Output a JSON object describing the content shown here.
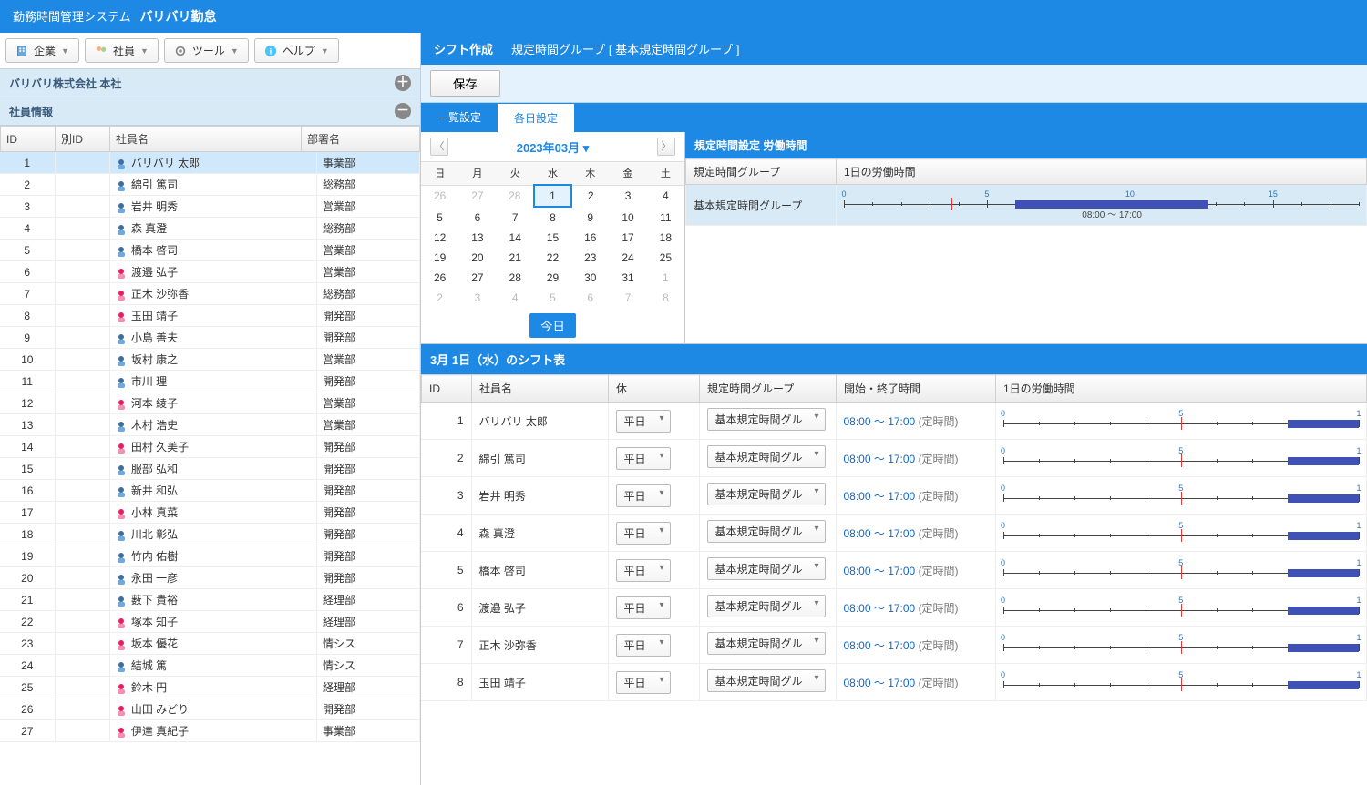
{
  "header": {
    "system_label": "勤務時間管理システム",
    "app_name": "バリバリ勤怠"
  },
  "toolbar": {
    "company": "企業",
    "employee": "社員",
    "tool": "ツール",
    "help": "ヘルプ"
  },
  "left": {
    "company_panel_title": "バリバリ株式会社 本社",
    "emp_panel_title": "社員情報",
    "columns": {
      "id": "ID",
      "alt_id": "別ID",
      "name": "社員名",
      "dept": "部署名"
    },
    "employees": [
      {
        "id": 1,
        "name": "バリバリ 太郎",
        "dept": "事業部",
        "g": "m"
      },
      {
        "id": 2,
        "name": "綿引 篤司",
        "dept": "総務部",
        "g": "m"
      },
      {
        "id": 3,
        "name": "岩井 明秀",
        "dept": "営業部",
        "g": "m"
      },
      {
        "id": 4,
        "name": "森 真澄",
        "dept": "総務部",
        "g": "m"
      },
      {
        "id": 5,
        "name": "橋本 啓司",
        "dept": "営業部",
        "g": "m"
      },
      {
        "id": 6,
        "name": "渡邉 弘子",
        "dept": "営業部",
        "g": "f"
      },
      {
        "id": 7,
        "name": "正木 沙弥香",
        "dept": "総務部",
        "g": "f"
      },
      {
        "id": 8,
        "name": "玉田 靖子",
        "dept": "開発部",
        "g": "f"
      },
      {
        "id": 9,
        "name": "小島 善夫",
        "dept": "開発部",
        "g": "m"
      },
      {
        "id": 10,
        "name": "坂村 康之",
        "dept": "営業部",
        "g": "m"
      },
      {
        "id": 11,
        "name": "市川 理",
        "dept": "開発部",
        "g": "m"
      },
      {
        "id": 12,
        "name": "河本 綾子",
        "dept": "営業部",
        "g": "f"
      },
      {
        "id": 13,
        "name": "木村 浩史",
        "dept": "営業部",
        "g": "m"
      },
      {
        "id": 14,
        "name": "田村 久美子",
        "dept": "開発部",
        "g": "f"
      },
      {
        "id": 15,
        "name": "服部 弘和",
        "dept": "開発部",
        "g": "m"
      },
      {
        "id": 16,
        "name": "新井 和弘",
        "dept": "開発部",
        "g": "m"
      },
      {
        "id": 17,
        "name": "小林 真菜",
        "dept": "開発部",
        "g": "f"
      },
      {
        "id": 18,
        "name": "川北 彰弘",
        "dept": "開発部",
        "g": "m"
      },
      {
        "id": 19,
        "name": "竹内 佑樹",
        "dept": "開発部",
        "g": "m"
      },
      {
        "id": 20,
        "name": "永田 一彦",
        "dept": "開発部",
        "g": "m"
      },
      {
        "id": 21,
        "name": "薮下 貴裕",
        "dept": "経理部",
        "g": "m"
      },
      {
        "id": 22,
        "name": "塚本 知子",
        "dept": "経理部",
        "g": "f"
      },
      {
        "id": 23,
        "name": "坂本 優花",
        "dept": "情シス",
        "g": "f"
      },
      {
        "id": 24,
        "name": "結城 篤",
        "dept": "情シス",
        "g": "m"
      },
      {
        "id": 25,
        "name": "鈴木 円",
        "dept": "経理部",
        "g": "f"
      },
      {
        "id": 26,
        "name": "山田 みどり",
        "dept": "開発部",
        "g": "f"
      },
      {
        "id": 27,
        "name": "伊達 真紀子",
        "dept": "事業部",
        "g": "f"
      }
    ]
  },
  "right": {
    "title_main": "シフト作成",
    "title_sub": "規定時間グループ [ 基本規定時間グループ ]",
    "save_label": "保存",
    "tabs": {
      "list": "一覧設定",
      "daily": "各日設定"
    },
    "calendar": {
      "month_label": "2023年03月 ▾",
      "dow": [
        "日",
        "月",
        "火",
        "水",
        "木",
        "金",
        "土"
      ],
      "weeks": [
        [
          {
            "d": 26,
            "o": 1
          },
          {
            "d": 27,
            "o": 1
          },
          {
            "d": 28,
            "o": 1
          },
          {
            "d": 1,
            "sel": 1
          },
          {
            "d": 2
          },
          {
            "d": 3
          },
          {
            "d": 4
          }
        ],
        [
          {
            "d": 5
          },
          {
            "d": 6
          },
          {
            "d": 7
          },
          {
            "d": 8
          },
          {
            "d": 9
          },
          {
            "d": 10
          },
          {
            "d": 11
          }
        ],
        [
          {
            "d": 12
          },
          {
            "d": 13
          },
          {
            "d": 14
          },
          {
            "d": 15
          },
          {
            "d": 16
          },
          {
            "d": 17
          },
          {
            "d": 18
          }
        ],
        [
          {
            "d": 19
          },
          {
            "d": 20
          },
          {
            "d": 21
          },
          {
            "d": 22
          },
          {
            "d": 23
          },
          {
            "d": 24
          },
          {
            "d": 25
          }
        ],
        [
          {
            "d": 26
          },
          {
            "d": 27
          },
          {
            "d": 28
          },
          {
            "d": 29
          },
          {
            "d": 30
          },
          {
            "d": 31
          },
          {
            "d": 1,
            "o": 1
          }
        ],
        [
          {
            "d": 2,
            "o": 1
          },
          {
            "d": 3,
            "o": 1
          },
          {
            "d": 4,
            "o": 1
          },
          {
            "d": 5,
            "o": 1
          },
          {
            "d": 6,
            "o": 1
          },
          {
            "d": 7,
            "o": 1
          },
          {
            "d": 8,
            "o": 1
          }
        ]
      ],
      "today_label": "今日"
    },
    "rule": {
      "header": "規定時間設定 労働時間",
      "col_group": "規定時間グループ",
      "col_hours": "1日の労働時間",
      "group_name": "基本規定時間グループ",
      "time_label": "08:00 ～ 17:00",
      "ticks": [
        0,
        5,
        10,
        15
      ],
      "bar_start_pct": 33.3,
      "bar_end_pct": 70.8,
      "red_pct": 20.8
    },
    "shift": {
      "header": "3月 1日（水）のシフト表",
      "cols": {
        "id": "ID",
        "name": "社員名",
        "holiday": "休",
        "group": "規定時間グループ",
        "times": "開始・終了時間",
        "hours": "1日の労働時間"
      },
      "holiday_value": "平日",
      "group_value": "基本規定時間グル",
      "time_text": "08:00 ～ 17:00",
      "time_note": "(定時間)",
      "mini_ticks": [
        0,
        5,
        "1"
      ],
      "rows": [
        {
          "id": 1,
          "name": "バリバリ 太郎"
        },
        {
          "id": 2,
          "name": "綿引 篤司"
        },
        {
          "id": 3,
          "name": "岩井 明秀"
        },
        {
          "id": 4,
          "name": "森 真澄"
        },
        {
          "id": 5,
          "name": "橋本 啓司"
        },
        {
          "id": 6,
          "name": "渡邉 弘子"
        },
        {
          "id": 7,
          "name": "正木 沙弥香"
        },
        {
          "id": 8,
          "name": "玉田 靖子"
        }
      ]
    }
  }
}
